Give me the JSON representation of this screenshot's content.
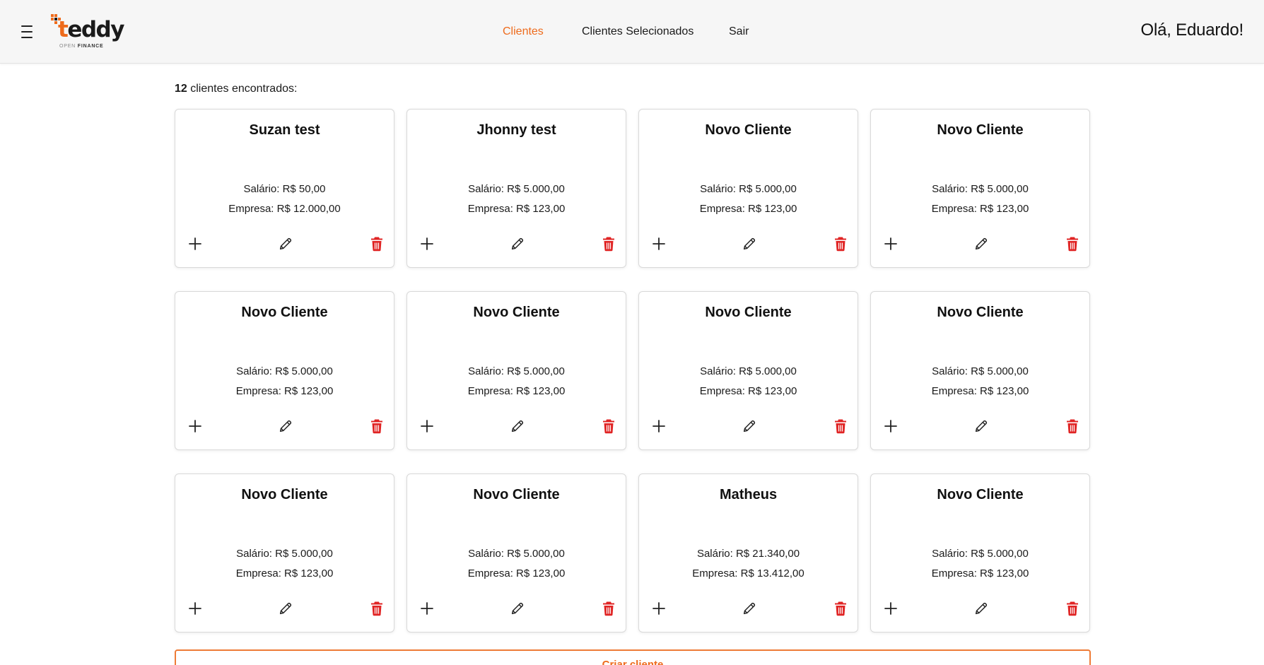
{
  "header": {
    "logo": {
      "name": "teddy",
      "subtitle_open": "OPEN",
      "subtitle_finance": "FINANCE",
      "accent": "#ee6b1c"
    },
    "nav": [
      {
        "label": "Clientes",
        "active": true
      },
      {
        "label": "Clientes Selecionados",
        "active": false
      },
      {
        "label": "Sair",
        "active": false
      }
    ],
    "greeting": "Olá, Eduardo!"
  },
  "summary": {
    "count": "12",
    "text": " clientes encontrados:"
  },
  "clients": [
    {
      "name": "Suzan test",
      "salary": "Salário: R$ 50,00",
      "company": "Empresa: R$ 12.000,00"
    },
    {
      "name": "Jhonny test",
      "salary": "Salário: R$ 5.000,00",
      "company": "Empresa: R$ 123,00"
    },
    {
      "name": "Novo Cliente",
      "salary": "Salário: R$ 5.000,00",
      "company": "Empresa: R$ 123,00"
    },
    {
      "name": "Novo Cliente",
      "salary": "Salário: R$ 5.000,00",
      "company": "Empresa: R$ 123,00"
    },
    {
      "name": "Novo Cliente",
      "salary": "Salário: R$ 5.000,00",
      "company": "Empresa: R$ 123,00"
    },
    {
      "name": "Novo Cliente",
      "salary": "Salário: R$ 5.000,00",
      "company": "Empresa: R$ 123,00"
    },
    {
      "name": "Novo Cliente",
      "salary": "Salário: R$ 5.000,00",
      "company": "Empresa: R$ 123,00"
    },
    {
      "name": "Novo Cliente",
      "salary": "Salário: R$ 5.000,00",
      "company": "Empresa: R$ 123,00"
    },
    {
      "name": "Novo Cliente",
      "salary": "Salário: R$ 5.000,00",
      "company": "Empresa: R$ 123,00"
    },
    {
      "name": "Novo Cliente",
      "salary": "Salário: R$ 5.000,00",
      "company": "Empresa: R$ 123,00"
    },
    {
      "name": "Matheus",
      "salary": "Salário: R$ 21.340,00",
      "company": "Empresa: R$ 13.412,00"
    },
    {
      "name": "Novo Cliente",
      "salary": "Salário: R$ 5.000,00",
      "company": "Empresa: R$ 123,00"
    }
  ],
  "card_icons": {
    "add": "plus-icon",
    "edit": "pencil-icon",
    "delete": "trash-icon",
    "delete_color": "#e02424"
  },
  "create_button": {
    "label": "Criar cliente"
  }
}
